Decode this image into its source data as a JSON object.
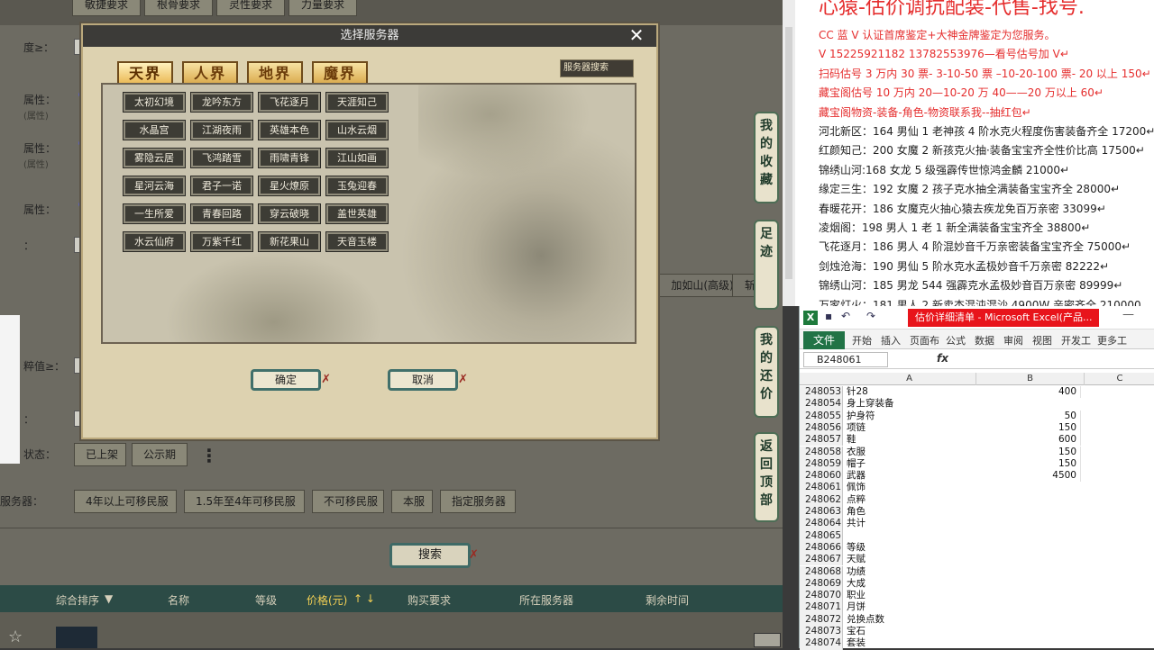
{
  "game": {
    "top_buttons": [
      "敏捷要求",
      "根骨要求",
      "灵性要求",
      "力量要求"
    ],
    "left_labels": [
      "度≥：",
      "属性：",
      "(属性)",
      "属性：",
      "(属性)",
      "属性：",
      "：",
      "粹值≥：",
      "：",
      "状态：",
      "服务器："
    ],
    "filter_mid": [
      "加如山(高级)",
      "斩"
    ],
    "status_buttons": [
      "已上架",
      "公示期"
    ],
    "more_icon": "⋮",
    "migrate_buttons": [
      "4年以上可移民服",
      "1.5年至4年可移民服",
      "不可移民服",
      "本服",
      "指定服务器"
    ],
    "search_label": "搜索",
    "table_headers": [
      "综合排序",
      "名称",
      "等级",
      "价格(元)",
      "购买要求",
      "所在服务器",
      "剩余时间"
    ],
    "sort_arrow": "▼",
    "price_arrows": "↑ ↓",
    "side_tabs": [
      "我的收藏",
      "足迹",
      "我的还价",
      "返回顶部"
    ],
    "row_star": "☆"
  },
  "dialog": {
    "title": "选择服务器",
    "close_icon": "✕",
    "realm_tabs": [
      "天界",
      "人界",
      "地界",
      "魔界"
    ],
    "server_search": "服务器搜索",
    "servers": [
      [
        "太初幻境",
        "龙吟东方",
        "飞花逐月",
        "天涯知己"
      ],
      [
        "水晶宫",
        "江湖夜雨",
        "英雄本色",
        "山水云烟"
      ],
      [
        "雾隐云居",
        "飞鸿踏雪",
        "雨啸青锋",
        "江山如画"
      ],
      [
        "星河云海",
        "君子一诺",
        "星火燎原",
        "玉兔迎春"
      ],
      [
        "一生所爱",
        "青春回路",
        "穿云破晓",
        "盖世英雄"
      ],
      [
        "水云仙府",
        "万紫千红",
        "新花果山",
        "天音玉楼"
      ]
    ],
    "confirm": "确定",
    "cancel": "取消",
    "tick": "✗"
  },
  "ad": {
    "title": "心猿-估价调抗配装-代售-找号.",
    "lines": [
      {
        "text": "CC 蓝 V 认证首席鉴定+大神金牌鉴定为您服务。",
        "color": "red"
      },
      {
        "text": "V 15225921182     13782553976—看号估号加 V↵",
        "color": "red"
      },
      {
        "text": "扫码估号 3 万内 30 票- 3-10-50 票  –10-20-100 票- 20 以上 150↵",
        "color": "red"
      },
      {
        "text": "藏宝阁估号 10 万内 20—10-20 万 40——20 万以上 60↵",
        "color": "red"
      },
      {
        "text": "藏宝阁物资-装备-角色-物资联系我--抽红包↵",
        "color": "red"
      },
      {
        "text": "河北新区：164 男仙 1 老神孩 4 阶水克火程度伤害装备齐全 17200↵",
        "color": "black"
      },
      {
        "text": "红颜知己：200 女魔 2 新孩克火抽·装备宝宝齐全性价比高 17500↵",
        "color": "black"
      },
      {
        "text": "锦绣山河:168 女龙 5 级强霹传世惊鸿金麟 21000↵",
        "color": "black"
      },
      {
        "text": "缘定三生：192 女魔 2 孩子克水抽全满装备宝宝齐全 28000↵",
        "color": "black"
      },
      {
        "text": "春暖花开：186 女魔克火抽心猿去疾龙免百万亲密 33099↵",
        "color": "black"
      },
      {
        "text": "凌烟阁：198 男人 1 老 1 新全满装备宝宝齐全 38800↵",
        "color": "black"
      },
      {
        "text": "飞花逐月：186 男人 4 阶混妙音千万亲密装备宝宝齐全 75000↵",
        "color": "black"
      },
      {
        "text": "剑烛沧海：190 男仙 5 阶水克水孟极妙音千万亲密 82222↵",
        "color": "black"
      },
      {
        "text": "锦绣山河：185 男龙 544 强霹克水孟极妙音百万亲密 89999↵",
        "color": "black"
      },
      {
        "text": "万家灯火：181 男人 2 新卖杰混沌混沙 4900W 亲密齐全 210000",
        "color": "black"
      }
    ]
  },
  "excel": {
    "app_icon": "X",
    "doc_title": "估价详细清单 - Microsoft Excel(产品...",
    "minimize": "—",
    "ribbon_tabs": [
      "开始",
      "插入",
      "页面布",
      "公式",
      "数据",
      "审阅",
      "视图",
      "开发工",
      "更多工"
    ],
    "file_tab": "文件",
    "name_box": "B248061",
    "fx": "fx",
    "columns": [
      "A",
      "B",
      "C"
    ],
    "rows": [
      {
        "n": "248053",
        "a": "针28",
        "b": "400"
      },
      {
        "n": "248054",
        "a": "身上穿装备",
        "b": ""
      },
      {
        "n": "248055",
        "a": "护身符",
        "b": "50"
      },
      {
        "n": "248056",
        "a": "项链",
        "b": "150"
      },
      {
        "n": "248057",
        "a": "鞋",
        "b": "600"
      },
      {
        "n": "248058",
        "a": "衣服",
        "b": "150"
      },
      {
        "n": "248059",
        "a": "帽子",
        "b": "150"
      },
      {
        "n": "248060",
        "a": "武器",
        "b": "4500"
      },
      {
        "n": "248061",
        "a": "佩饰",
        "b": ""
      },
      {
        "n": "248062",
        "a": "点粹",
        "b": ""
      },
      {
        "n": "248063",
        "a": "角色",
        "b": ""
      },
      {
        "n": "248064",
        "a": "共计",
        "b": ""
      },
      {
        "n": "248065",
        "a": "",
        "b": ""
      },
      {
        "n": "248066",
        "a": "等级",
        "b": ""
      },
      {
        "n": "248067",
        "a": "天赋",
        "b": ""
      },
      {
        "n": "248068",
        "a": "功绩",
        "b": ""
      },
      {
        "n": "248069",
        "a": "大成",
        "b": ""
      },
      {
        "n": "248070",
        "a": "职业",
        "b": ""
      },
      {
        "n": "248071",
        "a": "月饼",
        "b": ""
      },
      {
        "n": "248072",
        "a": "兑换点数",
        "b": ""
      },
      {
        "n": "248073",
        "a": "宝石",
        "b": ""
      },
      {
        "n": "248074",
        "a": "套装",
        "b": ""
      }
    ]
  }
}
